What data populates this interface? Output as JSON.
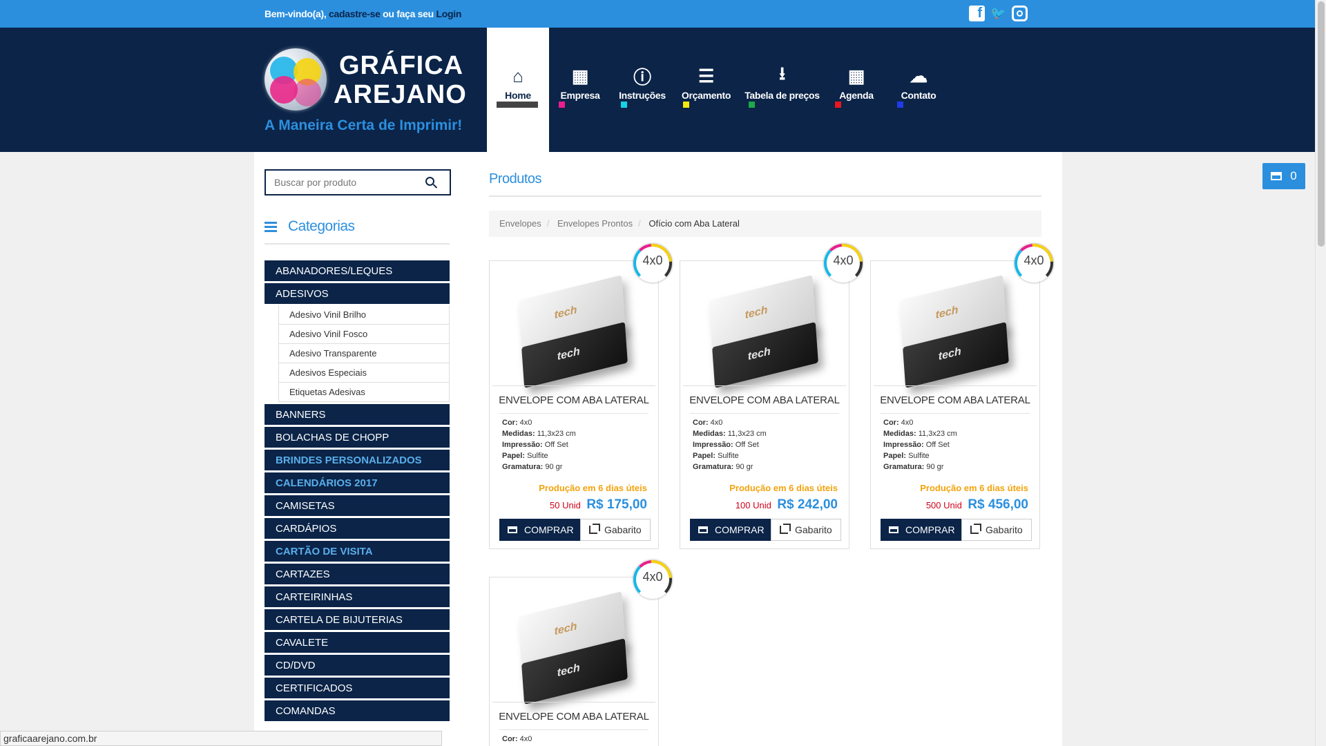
{
  "topbar": {
    "welcome": "Bem-vindo(a),",
    "register_link": "cadastre-se",
    "or_text": "ou faça seu",
    "login_link": "Login",
    "social": [
      "facebook-icon",
      "twitter-icon",
      "instagram-icon"
    ]
  },
  "brand": {
    "line1": "GRÁFICA",
    "line2": "AREJANO",
    "tagline": "A Maneira Certa de Imprimir!"
  },
  "nav": [
    {
      "label": "Home",
      "icon": "home-icon",
      "color": "#444444",
      "active": true
    },
    {
      "label": "Empresa",
      "icon": "building-icon",
      "color": "#e91e8c"
    },
    {
      "label": "Instruções",
      "icon": "info-icon",
      "color": "#16d2e8"
    },
    {
      "label": "Orçamento",
      "icon": "document-icon",
      "color": "#f5e80f"
    },
    {
      "label": "Tabela de preços",
      "icon": "download-icon",
      "color": "#1ea84a"
    },
    {
      "label": "Agenda",
      "icon": "calendar-icon",
      "color": "#e8161e"
    },
    {
      "label": "Contato",
      "icon": "chat-icon",
      "color": "#1e3ce8"
    }
  ],
  "search": {
    "placeholder": "Buscar por produto"
  },
  "categories_title": "Categorias",
  "categories": [
    {
      "label": "ABANADORES/LEQUES"
    },
    {
      "label": "ADESIVOS",
      "sub": [
        "Adesivo Vinil Brilho",
        "Adesivo Vinil Fosco",
        "Adesivo Transparente",
        "Adesivos Especiais",
        "Etiquetas Adesivas"
      ]
    },
    {
      "label": "BANNERS"
    },
    {
      "label": "BOLACHAS DE CHOPP"
    },
    {
      "label": "BRINDES PERSONALIZADOS",
      "highlight": true
    },
    {
      "label": "CALENDÁRIOS 2017",
      "highlight": true
    },
    {
      "label": "CAMISETAS"
    },
    {
      "label": "CARDÁPIOS"
    },
    {
      "label": "CARTÃO DE VISITA",
      "highlight": true
    },
    {
      "label": "CARTAZES"
    },
    {
      "label": "CARTEIRINHAS"
    },
    {
      "label": "CARTELA DE BIJUTERIAS"
    },
    {
      "label": "CAVALETE"
    },
    {
      "label": "CD/DVD"
    },
    {
      "label": "CERTIFICADOS"
    },
    {
      "label": "COMANDAS"
    }
  ],
  "products_title": "Produtos",
  "breadcrumb": [
    "Envelopes",
    "Envelopes Prontos",
    "Ofício com Aba Lateral"
  ],
  "cart_count": "0",
  "products": [
    {
      "badge": "4x0",
      "name": "ENVELOPE COM ABA LATERAL",
      "cor": "4x0",
      "medidas": "11,3x23 cm",
      "impressao": "Off Set",
      "papel": "Sulfite",
      "gramatura": "90 gr",
      "producao": "Produção em 6 dias úteis",
      "qty": "50 Unid",
      "price": "R$ 175,00",
      "buy": "COMPRAR",
      "gabarito": "Gabarito"
    },
    {
      "badge": "4x0",
      "name": "ENVELOPE COM ABA LATERAL",
      "cor": "4x0",
      "medidas": "11,3x23 cm",
      "impressao": "Off Set",
      "papel": "Sulfite",
      "gramatura": "90 gr",
      "producao": "Produção em 6 dias úteis",
      "qty": "100 Unid",
      "price": "R$ 242,00",
      "buy": "COMPRAR",
      "gabarito": "Gabarito"
    },
    {
      "badge": "4x0",
      "name": "ENVELOPE COM ABA LATERAL",
      "cor": "4x0",
      "medidas": "11,3x23 cm",
      "impressao": "Off Set",
      "papel": "Sulfite",
      "gramatura": "90 gr",
      "producao": "Produção em 6 dias úteis",
      "qty": "500 Unid",
      "price": "R$ 456,00",
      "buy": "COMPRAR",
      "gabarito": "Gabarito"
    },
    {
      "badge": "4x0",
      "name": "ENVELOPE COM ABA LATERAL",
      "cor": "4x0"
    }
  ],
  "spec_labels": {
    "cor": "Cor:",
    "medidas": "Medidas:",
    "impressao": "Impressão:",
    "papel": "Papel:",
    "gramatura": "Gramatura:"
  },
  "envelope_art": "tech",
  "status_url": "graficaarejano.com.br"
}
